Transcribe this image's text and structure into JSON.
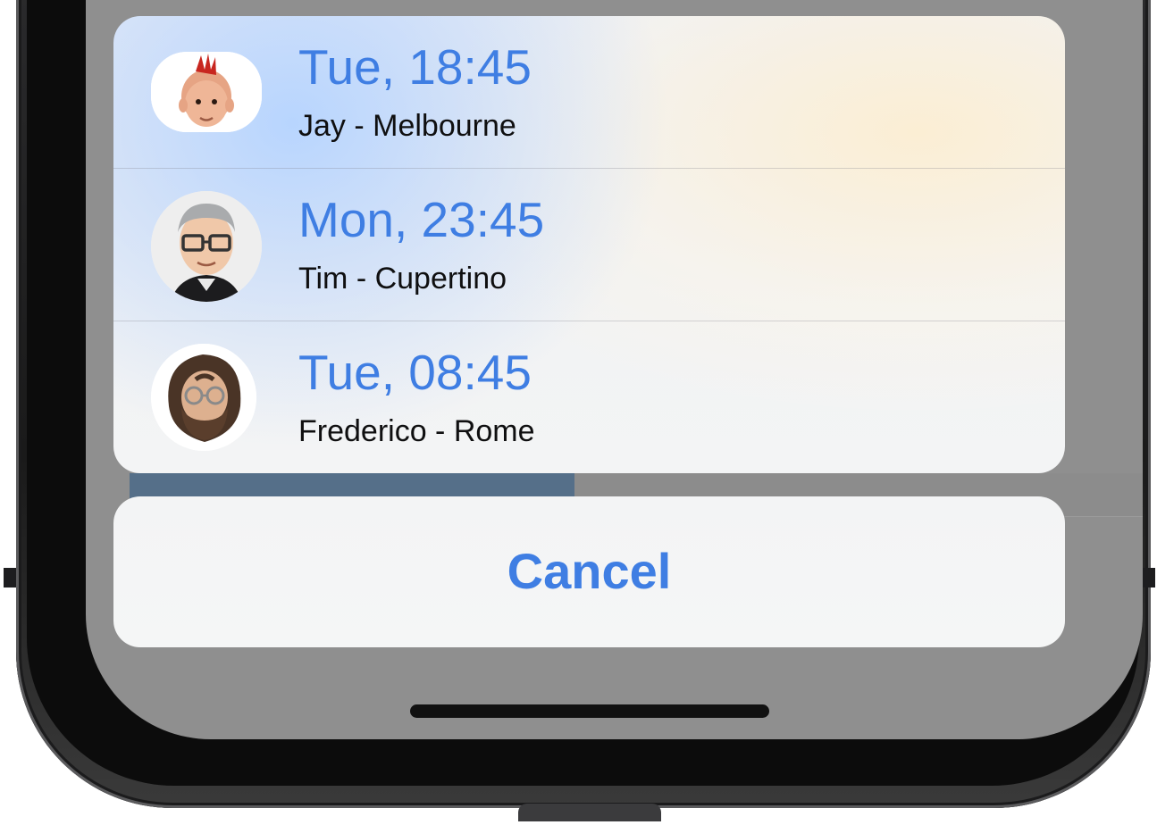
{
  "action_sheet": {
    "rows": [
      {
        "time": "Tue, 18:45",
        "subtitle": "Jay - Melbourne",
        "avatar": "memoji-red-mohawk"
      },
      {
        "time": "Mon, 23:45",
        "subtitle": "Tim - Cupertino",
        "avatar": "memoji-grey-hair-glasses"
      },
      {
        "time": "Tue, 08:45",
        "subtitle": "Frederico - Rome",
        "avatar": "memoji-beard-glasses"
      }
    ],
    "cancel_label": "Cancel"
  },
  "colors": {
    "accent": "#3f7ee3",
    "text": "#0f0f10",
    "dimmed_background": "#8f8f8f"
  }
}
